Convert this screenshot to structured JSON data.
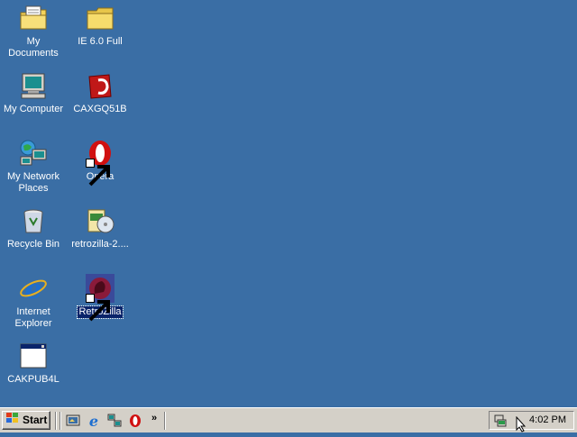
{
  "desktop": {
    "background_color": "#3a6ea5",
    "icons": [
      {
        "label": "My Documents",
        "icon": "my-documents-icon"
      },
      {
        "label": "IE 6.0 Full",
        "icon": "folder-icon"
      },
      {
        "label": "My Computer",
        "icon": "my-computer-icon"
      },
      {
        "label": "CAXGQ51B",
        "icon": "installer-icon"
      },
      {
        "label": "My Network",
        "label2": "Places",
        "icon": "network-places-icon"
      },
      {
        "label": "Opera",
        "icon": "opera-icon"
      },
      {
        "label": "Recycle Bin",
        "icon": "recycle-bin-icon"
      },
      {
        "label": "retrozilla-2....",
        "icon": "cd-setup-icon"
      },
      {
        "label": "Internet",
        "label2": "Explorer",
        "icon": "internet-explorer-icon"
      },
      {
        "label": "RetroZilla",
        "icon": "retrozilla-icon",
        "selected": true
      },
      {
        "label": "CAKPUB4L",
        "icon": "application-window-icon"
      }
    ]
  },
  "taskbar": {
    "start_label": "Start",
    "quick_launch": [
      "show-desktop-icon",
      "internet-explorer-icon",
      "network-icon",
      "opera-icon"
    ],
    "overflow": "»",
    "tray_icons": [
      "network-tray-icon"
    ],
    "clock": "4:02 PM"
  }
}
